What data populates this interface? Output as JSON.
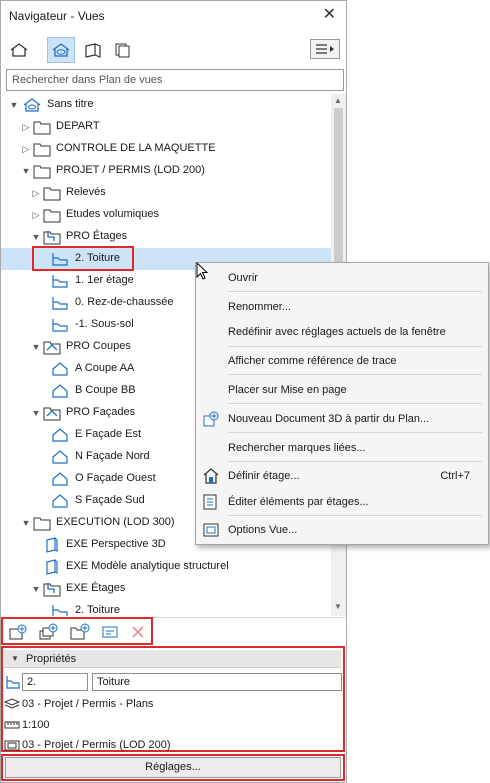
{
  "window": {
    "title": "Navigateur - Vues",
    "close_glyph": "✕"
  },
  "search": {
    "placeholder": "Rechercher dans Plan de vues"
  },
  "tree": [
    {
      "label": "Sans titre"
    },
    {
      "label": "DEPART"
    },
    {
      "label": "CONTROLE DE LA MAQUETTE"
    },
    {
      "label": "PROJET / PERMIS (LOD 200)"
    },
    {
      "label": "Relevés"
    },
    {
      "label": "Etudes volumiques"
    },
    {
      "label": "PRO Étages"
    },
    {
      "label": "2. Toiture"
    },
    {
      "label": "1. 1er étage"
    },
    {
      "label": "0. Rez-de-chaussée"
    },
    {
      "label": "-1. Sous-sol"
    },
    {
      "label": "PRO Coupes"
    },
    {
      "label": "A Coupe AA"
    },
    {
      "label": "B Coupe BB"
    },
    {
      "label": "PRO Façades"
    },
    {
      "label": "E Façade Est"
    },
    {
      "label": "N Façade Nord"
    },
    {
      "label": "O Façade Ouest"
    },
    {
      "label": "S Façade Sud"
    },
    {
      "label": "EXECUTION (LOD 300)"
    },
    {
      "label": "EXE Perspective 3D"
    },
    {
      "label": "EXE Modèle analytique structurel"
    },
    {
      "label": "EXE Étages"
    },
    {
      "label": "2. Toiture"
    }
  ],
  "properties": {
    "header": "Propriétés",
    "id_value": "2.",
    "name_value": "Toiture",
    "layer_combination": "03 - Projet / Permis - Plans",
    "scale": "1:100",
    "model_view": "03 - Projet / Permis (LOD 200)",
    "settings_button": "Réglages..."
  },
  "context_menu": {
    "open": "Ouvrir",
    "rename": "Renommer...",
    "redefine": "Redéfinir avec réglages actuels de la fenêtre",
    "show_as_trace": "Afficher comme référence de trace",
    "place_on_layout": "Placer sur Mise en page",
    "new_3d_doc": "Nouveau Document 3D à partir du Plan...",
    "find_markers": "Rechercher marques liées...",
    "define_story": "Définir étage...",
    "define_story_shortcut": "Ctrl+7",
    "edit_by_stories": "Éditer éléments par étages...",
    "view_options": "Options Vue..."
  },
  "colors": {
    "accent": "#1e6fc4",
    "highlight": "#e0282b",
    "selection": "#cde3f7"
  }
}
